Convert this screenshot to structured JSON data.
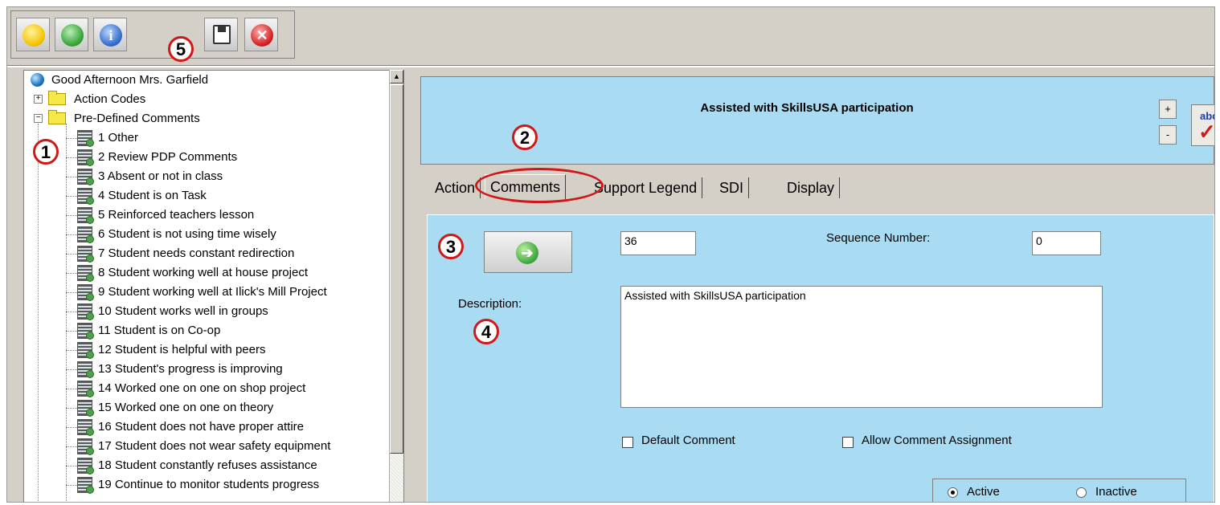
{
  "toolbar": {
    "buttons": [
      {
        "name": "smiley-icon",
        "color": "#f5c400"
      },
      {
        "name": "refresh-icon",
        "color": "#2e9e2e"
      },
      {
        "name": "info-icon",
        "color": "#2a66c8"
      },
      {
        "name": "save-icon",
        "color": "#333333"
      },
      {
        "name": "close-icon",
        "color": "#d11818"
      }
    ]
  },
  "tree": {
    "root": "Good Afternoon Mrs. Garfield",
    "folders": [
      "Action Codes",
      "Pre-Defined Comments"
    ],
    "items": [
      "1 Other",
      "2 Review PDP Comments",
      "3 Absent or not in class",
      "4 Student is on Task",
      "5 Reinforced teachers lesson",
      "6 Student is not using time wisely",
      "7 Student needs constant redirection",
      "8 Student working well at house project",
      "9 Student working well at Ilick's Mill Project",
      "10 Student works well in groups",
      "11 Student is on Co-op",
      "12 Student is helpful with peers",
      "13 Student's progress is improving",
      "14 Worked one on one on shop project",
      "15 Worked one on one on theory",
      "16 Student does not have proper attire",
      "17 Student does not wear safety equipment",
      "18 Student constantly refuses assistance",
      "19 Continue to monitor students progress"
    ]
  },
  "header": {
    "title": "Assisted with SkillsUSA participation",
    "plus": "+",
    "minus": "-",
    "spell_label": "abc"
  },
  "tabs": [
    "Action",
    "Comments",
    "Support Legend",
    "SDI",
    "Display"
  ],
  "form": {
    "id_value": "36",
    "sequence_label": "Sequence Number:",
    "sequence_value": "0",
    "description_label": "Description:",
    "description_value": "Assisted with SkillsUSA participation",
    "default_comment_label": "Default Comment",
    "allow_assignment_label": "Allow Comment Assignment",
    "active_label": "Active",
    "inactive_label": "Inactive",
    "status": "Active"
  },
  "markers": [
    "1",
    "2",
    "3",
    "4",
    "5"
  ]
}
